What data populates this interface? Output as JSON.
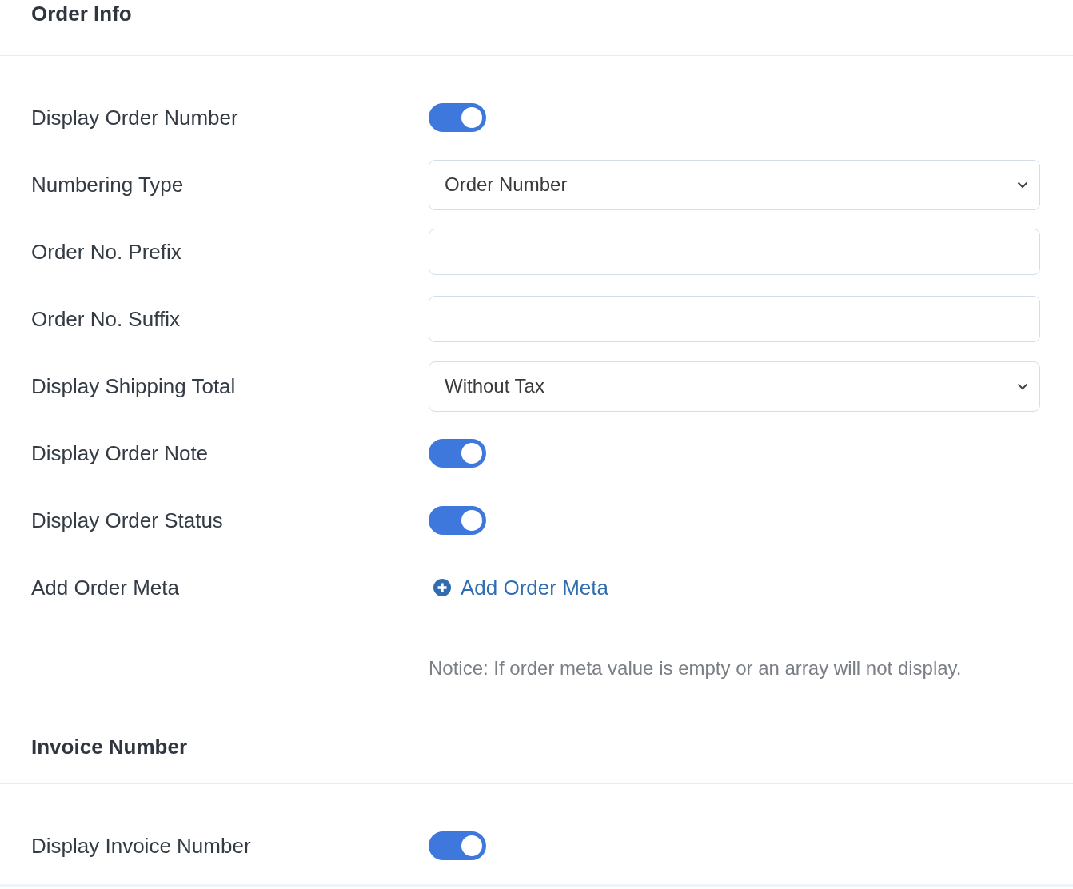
{
  "sections": [
    {
      "title": "Order Info",
      "rows": [
        {
          "kind": "toggle",
          "label": "Display Order Number",
          "on": true
        },
        {
          "kind": "select",
          "label": "Numbering Type",
          "value": "Order Number"
        },
        {
          "kind": "input",
          "label": "Order No. Prefix"
        },
        {
          "kind": "input",
          "label": "Order No. Suffix"
        },
        {
          "kind": "select",
          "label": "Display Shipping Total",
          "value": "Without Tax"
        },
        {
          "kind": "toggle",
          "label": "Display Order Note",
          "on": true
        },
        {
          "kind": "toggle",
          "label": "Display Order Status",
          "on": true
        },
        {
          "kind": "link",
          "label": "Add Order Meta",
          "link": "Add Order Meta"
        },
        {
          "kind": "notice",
          "text": "Notice: If order meta value is empty or an array will not display."
        }
      ]
    },
    {
      "title": "Invoice Number",
      "rows": [
        {
          "kind": "toggle",
          "label": "Display Invoice Number",
          "on": true
        }
      ]
    }
  ]
}
